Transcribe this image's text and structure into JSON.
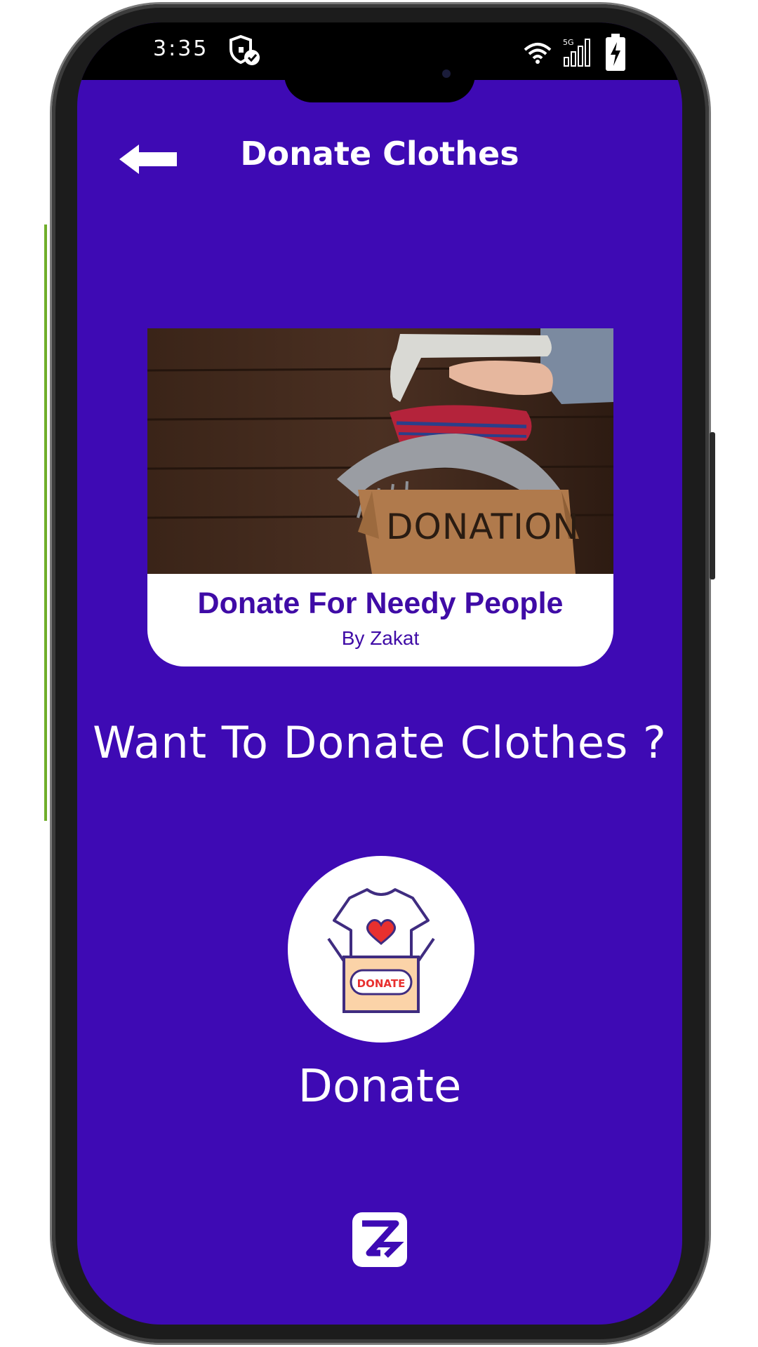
{
  "status_bar": {
    "time": "3:35",
    "icons": [
      "shield-check-icon",
      "wifi-icon",
      "5g-signal-icon",
      "battery-charging-icon"
    ],
    "network_label": "5G"
  },
  "header": {
    "title": "Donate Clothes",
    "back_icon": "back-arrow-icon"
  },
  "card": {
    "image": "clothes-donation-box-photo",
    "box_label": "DONATION",
    "title": "Donate For Needy People",
    "subtitle": "By Zakat"
  },
  "question": "Want To Donate Clothes ?",
  "donate_button": {
    "icon": "tshirt-donate-box-icon",
    "icon_text": "DONATE",
    "label": "Donate"
  },
  "footer_logo": "zakat-logo-icon",
  "colors": {
    "background": "#3e0ab4",
    "card_text": "#3f0ba6",
    "text": "#ffffff",
    "heart": "#e8302f",
    "box": "#fbd3a8"
  }
}
